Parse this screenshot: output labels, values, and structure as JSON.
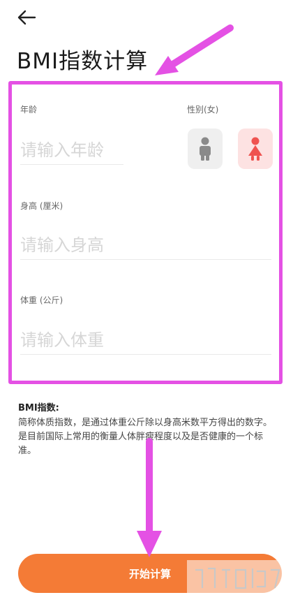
{
  "header": {
    "back_icon": "arrow-left-icon",
    "title": "BMI指数计算"
  },
  "form": {
    "age": {
      "label": "年龄",
      "placeholder": "请输入年龄",
      "value": ""
    },
    "gender": {
      "label": "性别(女)",
      "options": [
        {
          "name": "male",
          "icon": "male-person-icon",
          "selected": false
        },
        {
          "name": "female",
          "icon": "female-person-icon",
          "selected": true
        }
      ]
    },
    "height": {
      "label": "身高 (厘米)",
      "placeholder": "请输入身高",
      "value": ""
    },
    "weight": {
      "label": "体重 (公斤)",
      "placeholder": "请输入体重",
      "value": ""
    }
  },
  "info": {
    "heading": "BMI指数:",
    "description": "简称体质指数，是通过体重公斤除以身高米数平方得出的数字。是目前国际上常用的衡量人体胖瘦程度以及是否健康的一个标准。"
  },
  "action": {
    "start_label": "开始计算"
  },
  "colors": {
    "accent": "#f47b36",
    "annotation": "#e451e4",
    "female": "#ef5350",
    "male": "#8a8a8a"
  }
}
